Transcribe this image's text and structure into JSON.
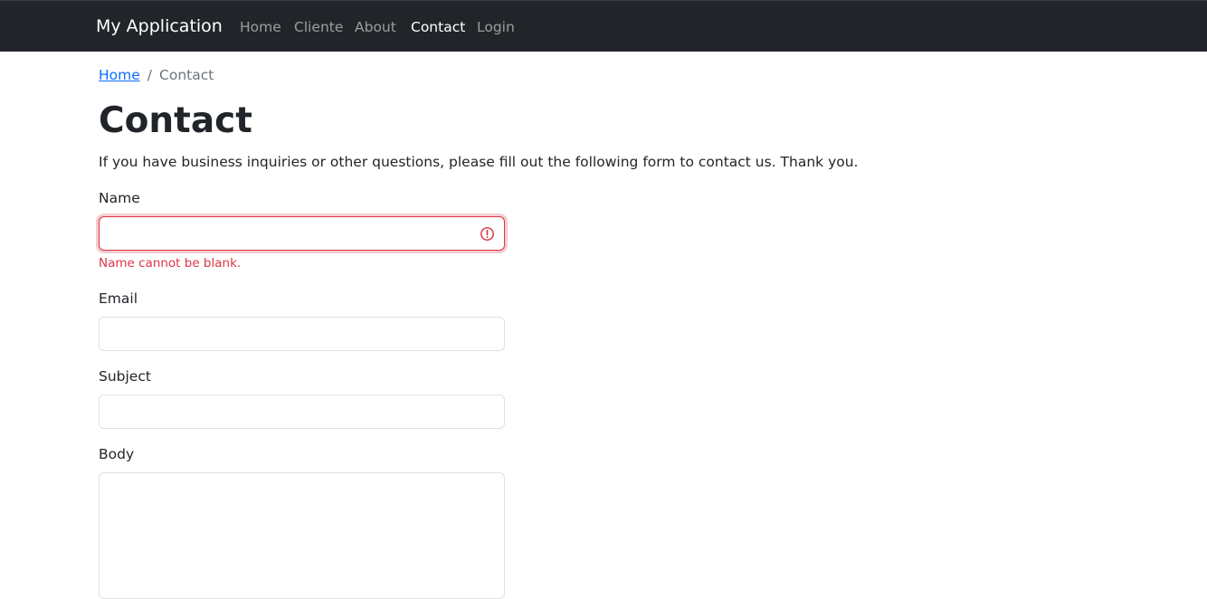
{
  "navbar": {
    "brand": "My Application",
    "items": [
      {
        "label": "Home",
        "active": false
      },
      {
        "label": "Cliente",
        "active": false
      },
      {
        "label": "About",
        "active": false
      },
      {
        "label": "Contact",
        "active": true
      },
      {
        "label": "Login",
        "active": false
      }
    ]
  },
  "breadcrumb": {
    "home": "Home",
    "separator": "/",
    "current": "Contact"
  },
  "page": {
    "title": "Contact",
    "intro": "If you have business inquiries or other questions, please fill out the following form to contact us. Thank you."
  },
  "form": {
    "name": {
      "label": "Name",
      "value": "",
      "error": "Name cannot be blank."
    },
    "email": {
      "label": "Email",
      "value": ""
    },
    "subject": {
      "label": "Subject",
      "value": ""
    },
    "body": {
      "label": "Body",
      "value": ""
    }
  },
  "colors": {
    "navbar_bg": "#212529",
    "link": "#0d6efd",
    "danger": "#dc3545",
    "muted": "#6c757d"
  },
  "icons": {
    "invalid": "exclamation-circle-icon"
  }
}
